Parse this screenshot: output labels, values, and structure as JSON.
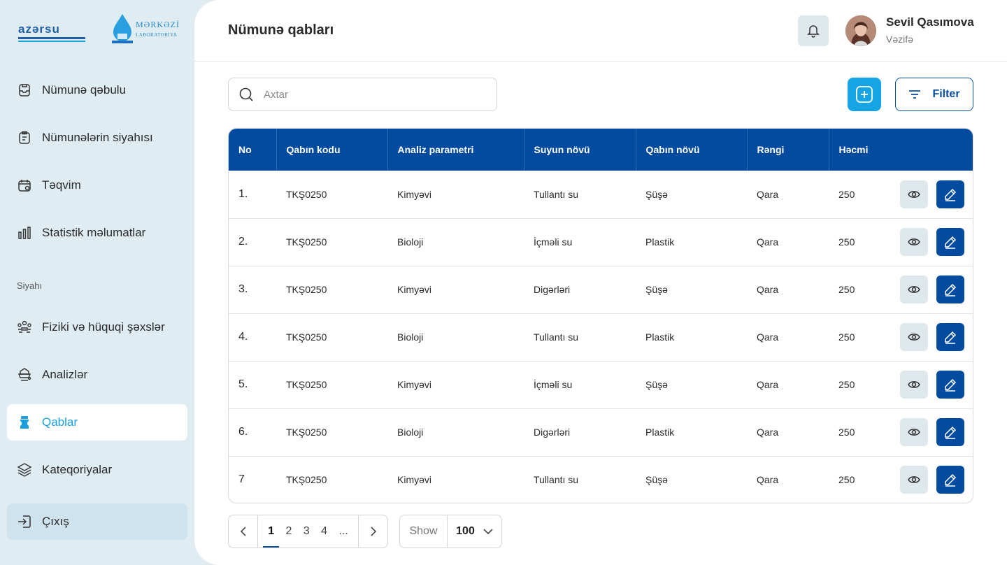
{
  "brand": {
    "logo_primary": "azərsu",
    "logo_secondary_title": "MƏRKƏZİ",
    "logo_secondary_subtitle": "LABORATORİYA"
  },
  "sidebar": {
    "items": [
      {
        "label": "Nümunə qəbulu",
        "icon": "clipboard-check-icon"
      },
      {
        "label": "Nümunələrin siyahısı",
        "icon": "clipboard-list-icon"
      },
      {
        "label": "Təqvim",
        "icon": "calendar-icon"
      },
      {
        "label": "Statistik məlumatlar",
        "icon": "bar-chart-icon"
      }
    ],
    "section_label": "Siyahı",
    "list_items": [
      {
        "label": "Fiziki və hüquqi şəxslər",
        "icon": "users-icon"
      },
      {
        "label": "Analizlər",
        "icon": "flask-icon"
      },
      {
        "label": "Qablar",
        "icon": "container-icon",
        "active": true
      },
      {
        "label": "Kateqoriyalar",
        "icon": "layers-icon"
      }
    ],
    "logout_label": "Çıxış"
  },
  "header": {
    "title": "Nümunə qabları",
    "user_name": "Sevil Qasımova",
    "user_role": "Vəzifə"
  },
  "toolbar": {
    "search_placeholder": "Axtar",
    "filter_label": "Filter"
  },
  "table": {
    "columns": [
      "No",
      "Qabın kodu",
      "Analiz parametri",
      "Suyun növü",
      "Qabın növü",
      "Rəngi",
      "Həcmi"
    ],
    "rows": [
      [
        "1.",
        "TKŞ0250",
        "Kimyəvi",
        "Tullantı su",
        "Şüşə",
        "Qara",
        "250"
      ],
      [
        "2.",
        "TKŞ0250",
        "Bioloji",
        "İçməli su",
        "Plastik",
        "Qara",
        "250"
      ],
      [
        "3.",
        "TKŞ0250",
        "Kimyəvi",
        "Digərləri",
        "Şüşə",
        "Qara",
        "250"
      ],
      [
        "4.",
        "TKŞ0250",
        "Bioloji",
        "Tullantı su",
        "Plastik",
        "Qara",
        "250"
      ],
      [
        "5.",
        "TKŞ0250",
        "Kimyəvi",
        "İçməli su",
        "Şüşə",
        "Qara",
        "250"
      ],
      [
        "6.",
        "TKŞ0250",
        "Bioloji",
        "Digərləri",
        "Plastik",
        "Qara",
        "250"
      ],
      [
        "7",
        "TKŞ0250",
        "Kimyəvi",
        "Tullantı su",
        "Şüşə",
        "Qara",
        "250"
      ]
    ]
  },
  "pagination": {
    "pages": [
      "1",
      "2",
      "3",
      "4",
      "..."
    ],
    "current": "1",
    "show_label": "Show",
    "show_value": "100"
  },
  "colors": {
    "primary": "#034b9e",
    "accent": "#16a4e4",
    "sidebar_bg": "#dfedf3"
  }
}
